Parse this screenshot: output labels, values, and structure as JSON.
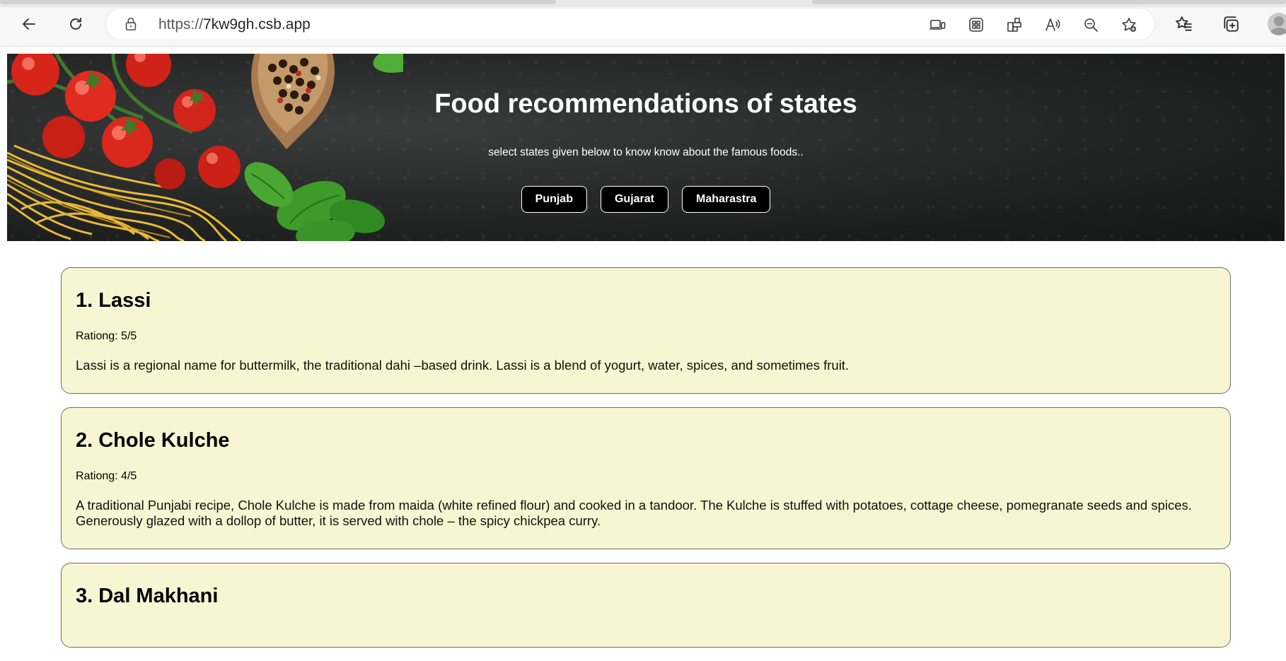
{
  "browser": {
    "url_protocol": "https://",
    "url_host": "7kw9gh.csb.app",
    "icons": {
      "back": "back-arrow-icon",
      "reload": "reload-icon",
      "lock": "lock-icon",
      "cast": "cast-device-icon",
      "apps": "apps-grid-icon",
      "extensions": "extensions-icon",
      "read_aloud": "read-aloud-icon",
      "zoom": "zoom-out-icon",
      "add_favorite": "add-favorite-icon",
      "favorites": "favorites-icon",
      "collections": "collections-icon",
      "profile": "profile-avatar"
    }
  },
  "hero": {
    "title": "Food recommendations of states",
    "subtitle": "select states given below to know know about the famous foods..",
    "states": [
      "Punjab",
      "Gujarat",
      "Maharastra"
    ]
  },
  "foods": [
    {
      "title": "1. Lassi",
      "rating": "Rationg: 5/5",
      "description": "Lassi is a regional name for buttermilk, the traditional dahi –based drink. Lassi is a blend of yogurt, water, spices, and sometimes fruit."
    },
    {
      "title": "2. Chole Kulche",
      "rating": "Rationg: 4/5",
      "description": "A traditional Punjabi recipe, Chole Kulche is made from maida (white refined flour) and cooked in a tandoor. The Kulche is stuffed with potatoes, cottage cheese, pomegranate seeds and spices. Generously glazed with a dollop of butter, it is served with chole – the spicy chickpea curry."
    },
    {
      "title": "3. Dal Makhani"
    }
  ],
  "colors": {
    "card_background": "#f6f7d2",
    "button_background": "#000000",
    "hero_text": "#ffffff"
  }
}
